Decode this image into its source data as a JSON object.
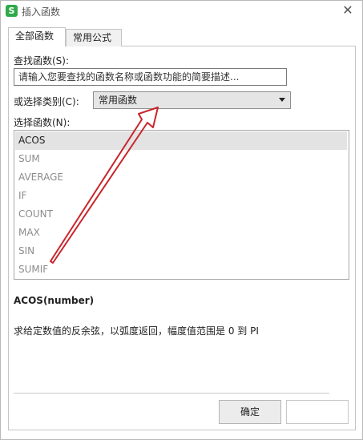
{
  "window": {
    "title": "插入函数",
    "app_icon_letter": "S"
  },
  "tabs": [
    {
      "label": "全部函数",
      "active": true
    },
    {
      "label": "常用公式",
      "active": false
    }
  ],
  "search": {
    "label": "查找函数(S):",
    "placeholder": "请输入您要查找的函数名称或函数功能的简要描述..."
  },
  "category": {
    "label": "或选择类别(C):",
    "selected": "常用函数"
  },
  "function_list": {
    "label": "选择函数(N):",
    "items": [
      "ACOS",
      "SUM",
      "AVERAGE",
      "IF",
      "COUNT",
      "MAX",
      "SIN",
      "SUMIF"
    ],
    "selected": "ACOS"
  },
  "details": {
    "syntax": "ACOS(number)",
    "description": "求给定数值的反余弦，以弧度返回，幅度值范围是 0 到 PI"
  },
  "buttons": {
    "ok": "确定"
  },
  "annotation": {
    "arrow_color": "#c8262c"
  }
}
